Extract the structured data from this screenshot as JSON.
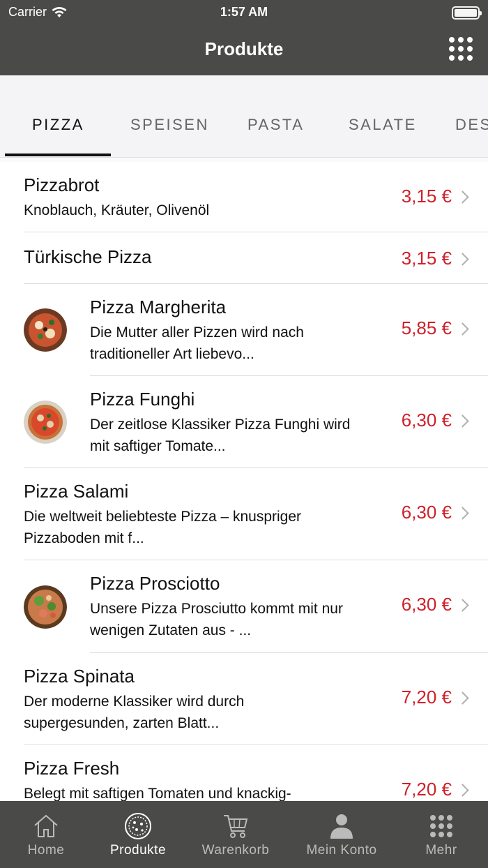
{
  "status": {
    "carrier": "Carrier",
    "time": "1:57 AM"
  },
  "nav": {
    "title": "Produkte"
  },
  "tabs": [
    {
      "label": "PIZZA"
    },
    {
      "label": "SPEISEN"
    },
    {
      "label": "PASTA"
    },
    {
      "label": "SALATE"
    },
    {
      "label": "DES"
    }
  ],
  "products": [
    {
      "name": "Pizzabrot",
      "desc": "Knoblauch, Kräuter, Olivenöl",
      "price": "3,15 €"
    },
    {
      "name": "Türkische Pizza",
      "desc": "",
      "price": "3,15 €"
    },
    {
      "name": "Pizza Margherita",
      "desc": "Die Mutter aller Pizzen wird nach traditioneller Art liebevo...",
      "price": "5,85 €"
    },
    {
      "name": "Pizza Funghi",
      "desc": "Der zeitlose Klassiker Pizza Funghi wird mit saftiger Tomate...",
      "price": "6,30 €"
    },
    {
      "name": "Pizza Salami",
      "desc": "Die weltweit beliebteste Pizza – knuspriger Pizzaboden mit f...",
      "price": "6,30 €"
    },
    {
      "name": "Pizza Prosciotto",
      "desc": "Unsere Pizza Prosciutto kommt mit nur wenigen Zutaten aus - ...",
      "price": "6,30 €"
    },
    {
      "name": "Pizza Spinata",
      "desc": "Der moderne Klassiker wird durch supergesunden, zarten Blatt...",
      "price": "7,20 €"
    },
    {
      "name": "Pizza Fresh",
      "desc": "Belegt mit saftigen Tomaten und knackig-",
      "price": "7,20 €"
    }
  ],
  "tabbar": [
    {
      "label": "Home",
      "icon": "home-icon"
    },
    {
      "label": "Produkte",
      "icon": "pizza-icon"
    },
    {
      "label": "Warenkorb",
      "icon": "cart-icon"
    },
    {
      "label": "Mein Konto",
      "icon": "person-icon"
    },
    {
      "label": "Mehr",
      "icon": "grid-icon"
    }
  ],
  "colors": {
    "bar": "#4a4a48",
    "price": "#d0202a",
    "tabs_bg": "#f4f4f6"
  }
}
